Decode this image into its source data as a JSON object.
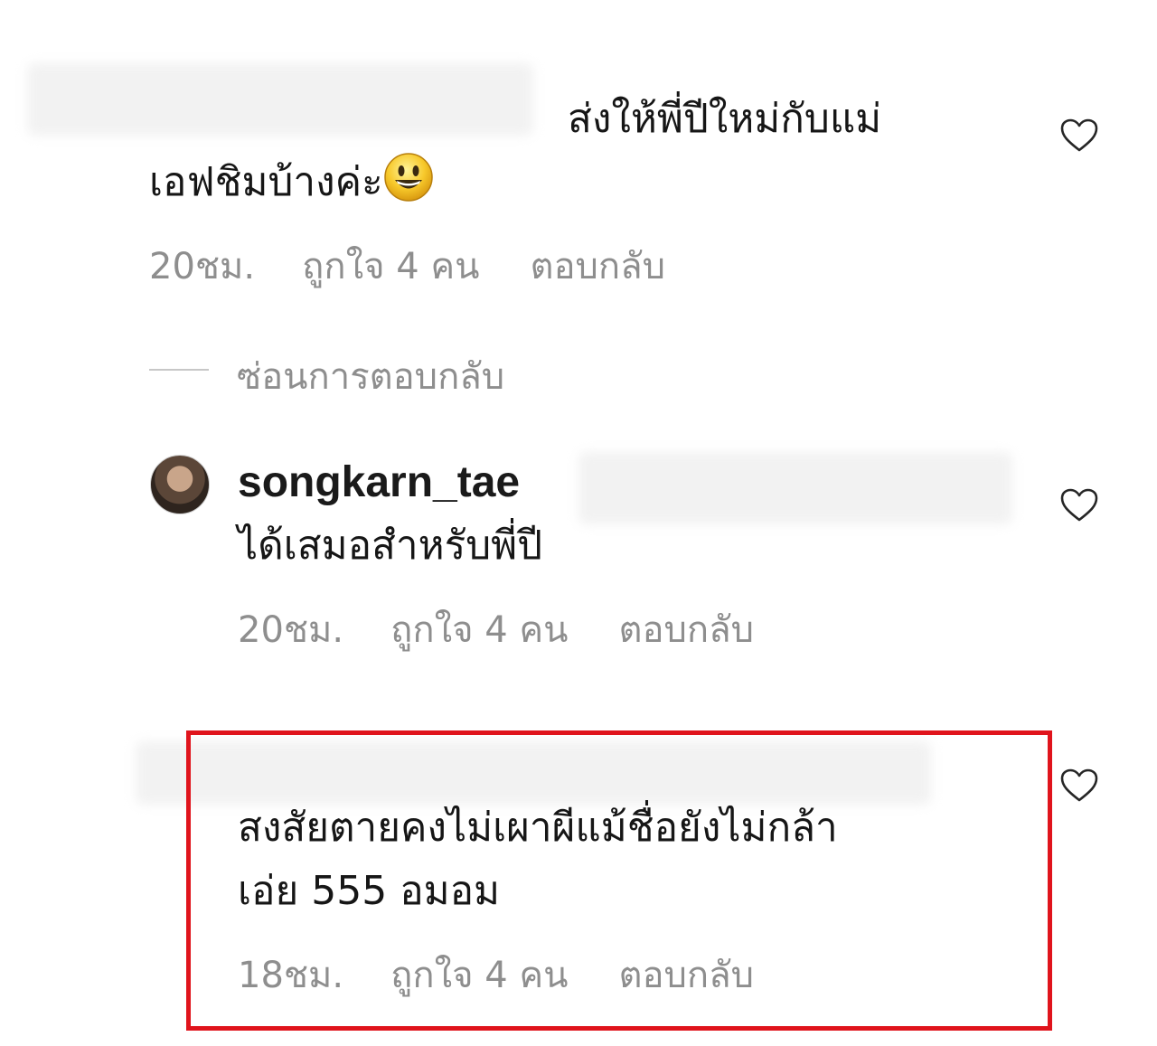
{
  "comments": [
    {
      "text_line1": "ส่งให้พี่ปีใหม่กับแม่",
      "text_line2": "เอฟชิมบ้างค่ะ",
      "emoji": "grinning-face-emoji",
      "time": "20ชม.",
      "likes": "ถูกใจ 4 คน",
      "reply": "ตอบกลับ"
    },
    {
      "username": "songkarn_tae",
      "text_line1": "ได้เสมอสำหรับพี่ปี",
      "time": "20ชม.",
      "likes": "ถูกใจ 4 คน",
      "reply": "ตอบกลับ"
    },
    {
      "text_line1": "สงสัยตายคงไม่เผาผีแม้ชื่อยังไม่กล้า",
      "text_line2": "เอ่ย 555 อมอม",
      "time": "18ชม.",
      "likes": "ถูกใจ 4 คน",
      "reply": "ตอบกลับ"
    }
  ],
  "hide_replies_label": "ซ่อนการตอบกลับ",
  "icons": {
    "like": "heart-outline-icon"
  },
  "colors": {
    "highlight": "#e0141c",
    "meta_text": "#8e8e8e"
  }
}
